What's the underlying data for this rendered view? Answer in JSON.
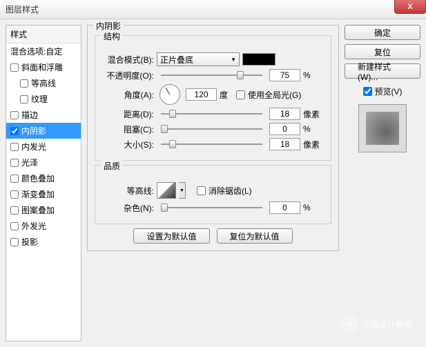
{
  "window": {
    "title": "图层样式"
  },
  "styles": {
    "header": "样式",
    "blend_opts": "混合选项:自定",
    "bevel": "斜面和浮雕",
    "contour": "等高线",
    "texture": "纹理",
    "stroke": "描边",
    "inner_shadow": "内阴影",
    "inner_glow": "内发光",
    "satin": "光泽",
    "color_overlay": "颜色叠加",
    "gradient_overlay": "渐变叠加",
    "pattern_overlay": "图案叠加",
    "outer_glow": "外发光",
    "drop_shadow": "投影"
  },
  "panel": {
    "title": "内阴影",
    "structure": "结构",
    "blend_mode_label": "混合模式(B):",
    "blend_mode_value": "正片叠底",
    "opacity_label": "不透明度(O):",
    "opacity_value": "75",
    "percent": "%",
    "angle_label": "角度(A):",
    "angle_value": "120",
    "angle_unit": "度",
    "global_light": "使用全局光(G)",
    "distance_label": "距离(D):",
    "distance_value": "18",
    "px": "像素",
    "choke_label": "阻塞(C):",
    "choke_value": "0",
    "size_label": "大小(S):",
    "size_value": "18",
    "quality": "品质",
    "contour_label": "等高线:",
    "antialias": "消除锯齿(L)",
    "noise_label": "杂色(N):",
    "noise_value": "0",
    "reset_default": "设置为默认值",
    "restore_default": "复位为默认值"
  },
  "buttons": {
    "ok": "确定",
    "cancel": "复位",
    "new_style": "新建样式(W)...",
    "preview": "预览(V)"
  },
  "watermark": "平面设计教程"
}
